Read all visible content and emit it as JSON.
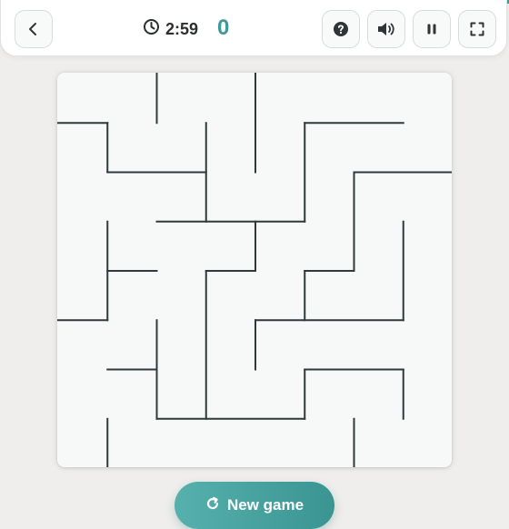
{
  "header": {
    "timer": "2:59",
    "score": "0",
    "accent_color": "#3d9a98",
    "icons": [
      "chevron-left-icon",
      "clock-icon",
      "help-icon",
      "volume-icon",
      "pause-icon",
      "fullscreen-icon"
    ]
  },
  "maze": {
    "size": 8,
    "walls": [
      [
        2,
        0,
        2,
        1
      ],
      [
        4,
        0,
        4,
        2
      ],
      [
        0,
        1,
        1,
        1
      ],
      [
        1,
        1,
        1,
        2
      ],
      [
        1,
        2,
        3,
        2
      ],
      [
        3,
        1,
        3,
        3
      ],
      [
        5,
        1,
        7,
        1
      ],
      [
        5,
        1,
        5,
        3
      ],
      [
        6,
        2,
        8,
        2
      ],
      [
        6,
        2,
        6,
        4
      ],
      [
        5,
        4,
        6,
        4
      ],
      [
        5,
        4,
        5,
        5
      ],
      [
        2,
        3,
        5,
        3
      ],
      [
        4,
        3,
        4,
        4
      ],
      [
        1,
        3,
        1,
        5
      ],
      [
        1,
        4,
        2,
        4
      ],
      [
        0,
        5,
        1,
        5
      ],
      [
        3,
        4,
        4,
        4
      ],
      [
        3,
        4,
        3,
        7
      ],
      [
        7,
        3,
        7,
        5
      ],
      [
        4,
        5,
        7,
        5
      ],
      [
        4,
        5,
        4,
        6
      ],
      [
        2,
        5,
        2,
        7
      ],
      [
        1,
        6,
        2,
        6
      ],
      [
        2,
        7,
        5,
        7
      ],
      [
        5,
        6,
        5,
        7
      ],
      [
        5,
        6,
        7,
        6
      ],
      [
        7,
        6,
        7,
        7
      ],
      [
        1,
        7,
        1,
        8
      ],
      [
        6,
        7,
        6,
        8
      ]
    ],
    "wall_color": "#2f3b3b"
  },
  "new_game": {
    "label": "New game"
  }
}
